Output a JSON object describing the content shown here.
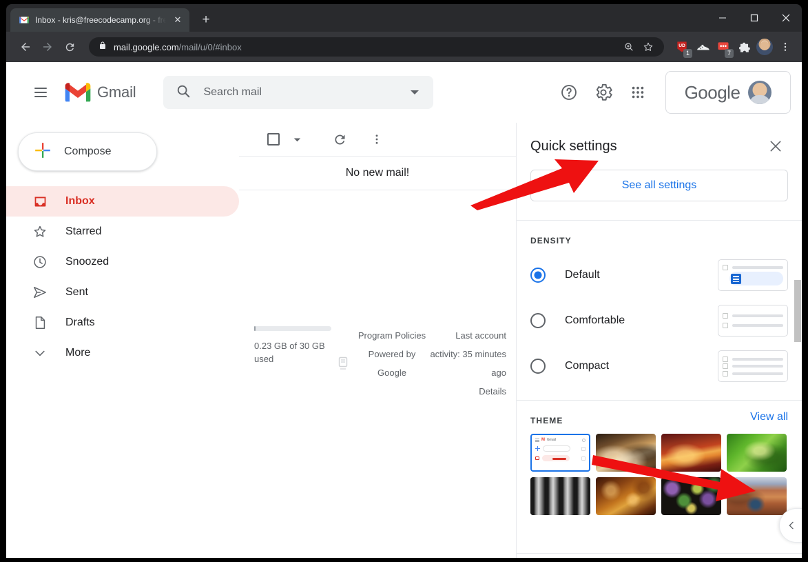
{
  "browser": {
    "tab": {
      "title": "Inbox - kris@freecodecamp.org - fre",
      "favicon": "gmail-icon",
      "close_label": "✕"
    },
    "new_tab_label": "+",
    "window_controls": {
      "minimize": "–",
      "maximize": "□",
      "close": "✕"
    },
    "nav": {
      "back": "←",
      "forward": "→",
      "reload": "↻"
    },
    "omnibox": {
      "lock_icon": "lock-icon",
      "url_domain": "mail.google.com",
      "url_path": "/mail/u/0/#inbox",
      "zoom_icon": "zoom-icon",
      "bookmark_icon": "star-icon"
    },
    "extensions": [
      {
        "name": "ud-extension",
        "label": "UD",
        "badge": "1",
        "color": "#c5221f"
      },
      {
        "name": "sneaker-extension",
        "label": "",
        "badge": "",
        "color": ""
      },
      {
        "name": "red-extension",
        "label": "",
        "badge": "7",
        "color": "#e8453c"
      },
      {
        "name": "puzzle-extensions-icon",
        "label": "",
        "badge": "",
        "color": ""
      }
    ],
    "profile_icon": "profile-avatar",
    "menu_icon": "three-dot-menu-icon"
  },
  "gmail": {
    "menu_icon": "hamburger-menu-icon",
    "logo_text": "Gmail",
    "search": {
      "placeholder": "Search mail",
      "value": "",
      "icon": "search-icon",
      "options_icon": "show-search-options-icon"
    },
    "header_actions": {
      "help": "help-icon",
      "settings": "gear-icon",
      "apps": "google-apps-icon"
    },
    "account_chip": {
      "label": "Google",
      "avatar": "account-avatar"
    }
  },
  "sidebar": {
    "compose": {
      "label": "Compose",
      "icon": "plus-icon"
    },
    "items": [
      {
        "label": "Inbox",
        "icon": "inbox-icon",
        "active": true
      },
      {
        "label": "Starred",
        "icon": "star-icon",
        "active": false
      },
      {
        "label": "Snoozed",
        "icon": "clock-icon",
        "active": false
      },
      {
        "label": "Sent",
        "icon": "send-icon",
        "active": false
      },
      {
        "label": "Drafts",
        "icon": "draft-icon",
        "active": false
      },
      {
        "label": "More",
        "icon": "chevron-down-icon",
        "active": false
      }
    ]
  },
  "maillist": {
    "toolbar": {
      "select_all": "select-all-checkbox",
      "select_caret": "chevron-down-icon",
      "refresh": "refresh-icon",
      "more": "more-options-icon"
    },
    "empty_message": "No new mail!"
  },
  "footer": {
    "storage_text": "0.23 GB of 30 GB used",
    "storage_percent": 0.77,
    "links_mid": [
      "Program Policies",
      "Powered by Google"
    ],
    "activity_text": "Last account activity: 35 minutes ago",
    "details_link": "Details"
  },
  "quick_settings": {
    "title": "Quick settings",
    "close_icon": "close-icon",
    "see_all_label": "See all settings",
    "density": {
      "label": "DENSITY",
      "options": [
        {
          "label": "Default",
          "selected": true
        },
        {
          "label": "Comfortable",
          "selected": false
        },
        {
          "label": "Compact",
          "selected": false
        }
      ]
    },
    "theme": {
      "label": "THEME",
      "view_all_label": "View all",
      "thumbnails": [
        {
          "name": "default-gmail-theme",
          "selected": true,
          "style": "mini"
        },
        {
          "name": "chess-theme",
          "selected": false,
          "style": "th-chess"
        },
        {
          "name": "canyon-sunset-theme",
          "selected": false,
          "style": "th-canyon"
        },
        {
          "name": "green-leaf-theme",
          "selected": false,
          "style": "th-leaf"
        },
        {
          "name": "metal-tubes-theme",
          "selected": false,
          "style": "th-tubes"
        },
        {
          "name": "autumn-leaves-theme",
          "selected": false,
          "style": "th-leaves"
        },
        {
          "name": "berries-theme",
          "selected": false,
          "style": "th-berries"
        },
        {
          "name": "river-canyon-theme",
          "selected": false,
          "style": "th-river"
        }
      ]
    },
    "collapse_icon": "chevron-left-icon",
    "scrollbar": "vertical-scrollbar"
  },
  "annotations": [
    {
      "name": "arrow-to-settings-gear",
      "color": "#ee1111",
      "points_to": "gear-icon"
    },
    {
      "name": "arrow-to-view-all",
      "color": "#ee1111",
      "points_to": "view-all-link"
    }
  ]
}
